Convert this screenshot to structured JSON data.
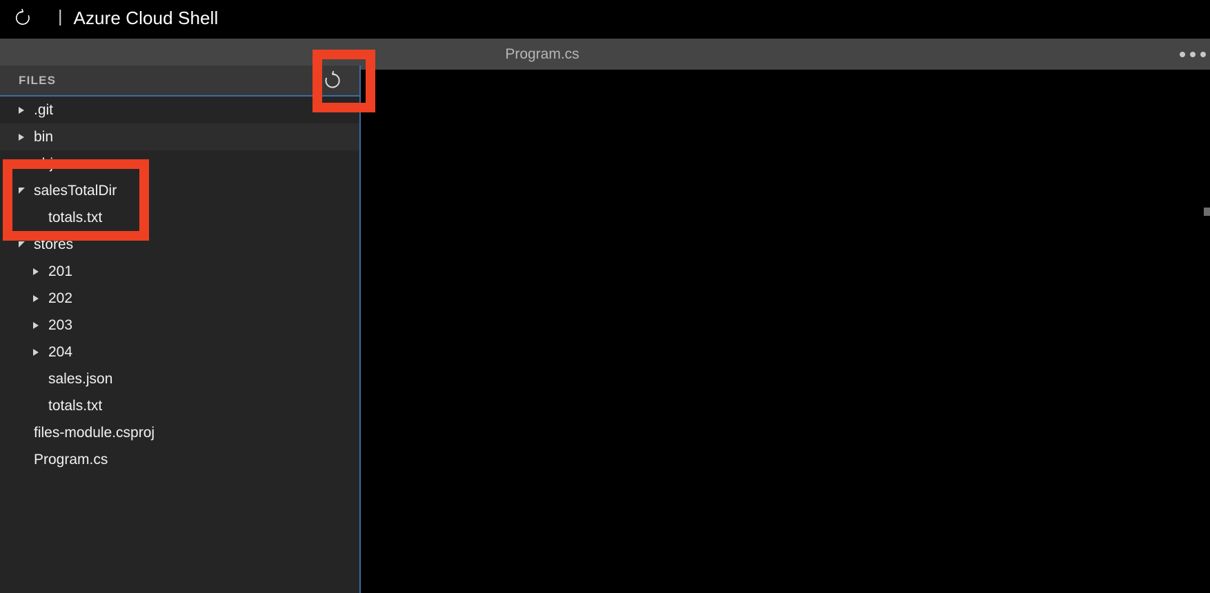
{
  "titlebar": {
    "restart_icon": "restart-icon",
    "separator": "|",
    "title": "Azure Cloud Shell"
  },
  "tabstrip": {
    "active_tab": "Program.cs",
    "more_icon": "ellipsis-icon"
  },
  "sidebar": {
    "header_title": "FILES",
    "refresh_icon": "refresh-icon",
    "tree": [
      {
        "label": ".git",
        "depth": 0,
        "type": "folder",
        "state": "collapsed",
        "hover": false
      },
      {
        "label": "bin",
        "depth": 0,
        "type": "folder",
        "state": "collapsed",
        "hover": true
      },
      {
        "label": "obj",
        "depth": 0,
        "type": "folder",
        "state": "collapsed",
        "hover": false
      },
      {
        "label": "salesTotalDir",
        "depth": 0,
        "type": "folder",
        "state": "expanded",
        "hover": false
      },
      {
        "label": "totals.txt",
        "depth": 1,
        "type": "file",
        "state": "none",
        "hover": false
      },
      {
        "label": "stores",
        "depth": 0,
        "type": "folder",
        "state": "expanded",
        "hover": false
      },
      {
        "label": "201",
        "depth": 1,
        "type": "folder",
        "state": "collapsed",
        "hover": false
      },
      {
        "label": "202",
        "depth": 1,
        "type": "folder",
        "state": "collapsed",
        "hover": false
      },
      {
        "label": "203",
        "depth": 1,
        "type": "folder",
        "state": "collapsed",
        "hover": false
      },
      {
        "label": "204",
        "depth": 1,
        "type": "folder",
        "state": "collapsed",
        "hover": false
      },
      {
        "label": "sales.json",
        "depth": 1,
        "type": "file",
        "state": "none",
        "hover": false
      },
      {
        "label": "totals.txt",
        "depth": 1,
        "type": "file",
        "state": "none",
        "hover": false
      },
      {
        "label": "files-module.csproj",
        "depth": 0,
        "type": "file",
        "state": "none",
        "hover": false
      },
      {
        "label": "Program.cs",
        "depth": 0,
        "type": "file",
        "state": "none",
        "hover": false
      }
    ]
  },
  "editor": {
    "content": "",
    "scrollbar_thumb": "scrollbar-thumb"
  },
  "annotations": [
    {
      "name": "refresh-button-highlight",
      "target": "refresh-icon"
    },
    {
      "name": "salestotaldir-highlight",
      "target": "salesTotalDir"
    }
  ],
  "colors": {
    "annotation_red": "#ee4023",
    "accent_blue": "#3a6ea5",
    "sidebar_bg": "#252526",
    "header_bg": "#383838",
    "tabstrip_bg": "#454545",
    "titlebar_bg": "#000000",
    "editor_bg": "#000000",
    "text_primary": "#f2f2f2",
    "text_muted": "#b6b6b6"
  }
}
